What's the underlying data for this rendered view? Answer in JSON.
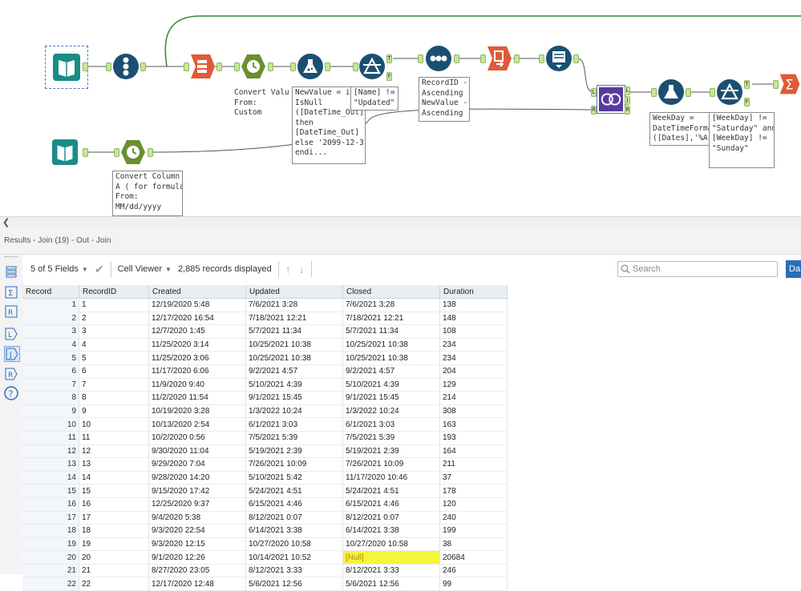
{
  "canvas": {
    "annotations": {
      "convert_value": "Convert Value\nFrom:\nCustom",
      "new_value_formula": "NewValue = if !\nIsNull\n([DateTime_Out])\nthen\n[DateTime_Out]\nelse '2099-12-31'\nendi...",
      "name_filter": "[Name] !=\n\"Updated\"",
      "sort_config": "RecordID -\nAscending\nNewValue -\nAscending",
      "weekday_formula": "WeekDay =\nDateTimeForma\n([Dates],'%A')",
      "weekday_filter": "[WeekDay] !=\n\"Saturday\" and\n[WeekDay] !=\n\"Sunday\"",
      "convert_column": "Convert Column\nA ( for formula)\nFrom:\nMM/dd/yyyy"
    },
    "anchor_labels": {
      "true": "T",
      "false": "F",
      "left": "L",
      "join": "J",
      "right": "R"
    }
  },
  "results": {
    "title": "Results - Join (19) - Out - Join",
    "fields_selector": "5 of 5 Fields",
    "cell_viewer": "Cell Viewer",
    "records_displayed": "2,885 records displayed",
    "search_placeholder": "Search",
    "day_button": "Da",
    "columns": [
      "Record",
      "RecordID",
      "Created",
      "Updated",
      "Closed",
      "Duration"
    ],
    "rows": [
      [
        "1",
        "1",
        "12/19/2020 5:48",
        "7/6/2021 3:28",
        "7/6/2021 3:28",
        "138"
      ],
      [
        "2",
        "2",
        "12/17/2020 16:54",
        "7/18/2021 12:21",
        "7/18/2021 12:21",
        "148"
      ],
      [
        "3",
        "3",
        "12/7/2020 1:45",
        "5/7/2021 11:34",
        "5/7/2021 11:34",
        "108"
      ],
      [
        "4",
        "4",
        "11/25/2020 3:14",
        "10/25/2021 10:38",
        "10/25/2021 10:38",
        "234"
      ],
      [
        "5",
        "5",
        "11/25/2020 3:06",
        "10/25/2021 10:38",
        "10/25/2021 10:38",
        "234"
      ],
      [
        "6",
        "6",
        "11/17/2020 6:06",
        "9/2/2021 4:57",
        "9/2/2021 4:57",
        "204"
      ],
      [
        "7",
        "7",
        "11/9/2020 9:40",
        "5/10/2021 4:39",
        "5/10/2021 4:39",
        "129"
      ],
      [
        "8",
        "8",
        "11/2/2020 11:54",
        "9/1/2021 15:45",
        "9/1/2021 15:45",
        "214"
      ],
      [
        "9",
        "9",
        "10/19/2020 3:28",
        "1/3/2022 10:24",
        "1/3/2022 10:24",
        "308"
      ],
      [
        "10",
        "10",
        "10/13/2020 2:54",
        "6/1/2021 3:03",
        "6/1/2021 3:03",
        "163"
      ],
      [
        "11",
        "11",
        "10/2/2020 0:56",
        "7/5/2021 5:39",
        "7/5/2021 5:39",
        "193"
      ],
      [
        "12",
        "12",
        "9/30/2020 11:04",
        "5/19/2021 2:39",
        "5/19/2021 2:39",
        "164"
      ],
      [
        "13",
        "13",
        "9/29/2020 7:04",
        "7/26/2021 10:09",
        "7/26/2021 10:09",
        "211"
      ],
      [
        "14",
        "14",
        "9/28/2020 14:20",
        "5/10/2021 5:42",
        "11/17/2020 10:46",
        "37"
      ],
      [
        "15",
        "15",
        "9/15/2020 17:42",
        "5/24/2021 4:51",
        "5/24/2021 4:51",
        "178"
      ],
      [
        "16",
        "16",
        "12/25/2020 9:37",
        "6/15/2021 4:46",
        "6/15/2021 4:46",
        "120"
      ],
      [
        "17",
        "17",
        "9/4/2020 5:38",
        "8/12/2021 0:07",
        "8/12/2021 0:07",
        "240"
      ],
      [
        "18",
        "18",
        "9/3/2020 22:54",
        "6/14/2021 3:38",
        "6/14/2021 3:38",
        "199"
      ],
      [
        "19",
        "19",
        "9/3/2020 12:15",
        "10/27/2020 10:58",
        "10/27/2020 10:58",
        "38"
      ],
      [
        "20",
        "20",
        "9/1/2020 12:26",
        "10/14/2021 10:52",
        "[Null]",
        "20684"
      ],
      [
        "21",
        "21",
        "8/27/2020 23:05",
        "8/12/2021 3:33",
        "8/12/2021 3:33",
        "246"
      ],
      [
        "22",
        "22",
        "12/17/2020 12:48",
        "5/6/2021 12:56",
        "5/6/2021 12:56",
        "99"
      ]
    ],
    "highlight_color": "#f5f53a",
    "null_color": "#b08a1e"
  },
  "colors": {
    "accent": "#2a6ebb",
    "wire_green": "#2e8b2e",
    "tool_blue": "#1b4f72",
    "tool_teal": "#1a8c86",
    "tool_orange": "#e05a3a",
    "tool_olive": "#6a8f2e",
    "tool_purple": "#5b3aa0"
  }
}
